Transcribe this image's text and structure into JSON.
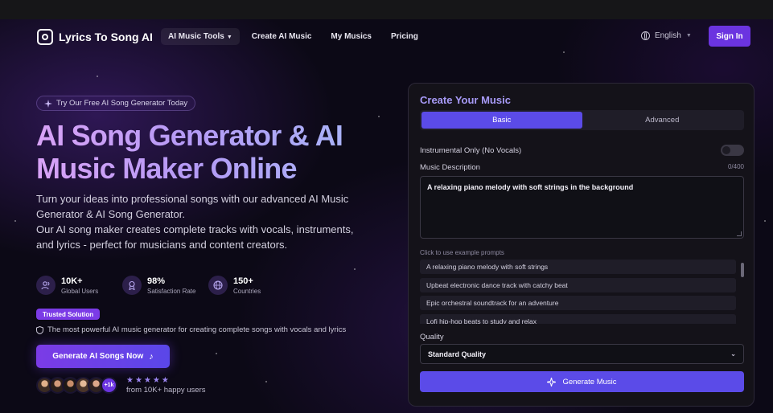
{
  "nav": {
    "logo_text": "Lyrics To Song AI",
    "links": [
      "AI Music Tools",
      "Create AI Music",
      "My Musics",
      "Pricing"
    ],
    "language": "English",
    "sign_in": "Sign In"
  },
  "hero": {
    "badge": "Try Our Free AI Song Generator Today",
    "title_line1": "AI Song Generator & AI",
    "title_line2": "Music Maker Online",
    "lead_1": "Turn your ideas into professional songs with our advanced AI Music Generator & AI Song Generator.",
    "lead_2": "Our AI song maker creates complete tracks with vocals, instruments, and lyrics - perfect for musicians and content creators.",
    "stats": [
      {
        "value": "10K+",
        "label": "Global Users",
        "icon": "users-icon"
      },
      {
        "value": "98%",
        "label": "Satisfaction Rate",
        "icon": "award-icon"
      },
      {
        "value": "150+",
        "label": "Countries",
        "icon": "globe-icon"
      }
    ],
    "trusted": "Trusted Solution",
    "tagline": "The most powerful AI music generator for creating complete songs with vocals and lyrics",
    "cta": "Generate AI Songs Now",
    "avatar_more": "+1k",
    "rating_stars": "★★★★★",
    "happy_users": "from 10K+ happy users"
  },
  "panel": {
    "title": "Create Your Music",
    "tabs": [
      "Basic",
      "Advanced"
    ],
    "instrumental_label": "Instrumental Only (No Vocals)",
    "description_label": "Music Description",
    "char_count": "0/400",
    "description_value": "A relaxing piano melody with soft strings in the background",
    "examples_hint": "Click to use example prompts",
    "examples": [
      "A relaxing piano melody with soft strings",
      "Upbeat electronic dance track with catchy beat",
      "Epic orchestral soundtrack for an adventure",
      "Lofi hip-hop beats to study and relax"
    ],
    "quality_label": "Quality",
    "quality_value": "Standard Quality",
    "generate_button": "Generate Music"
  },
  "colors": {
    "accent": "#5b4be8",
    "brand_purple": "#6b34e0",
    "title_gradient": [
      "#d9a3f7",
      "#a7b6f8"
    ]
  }
}
